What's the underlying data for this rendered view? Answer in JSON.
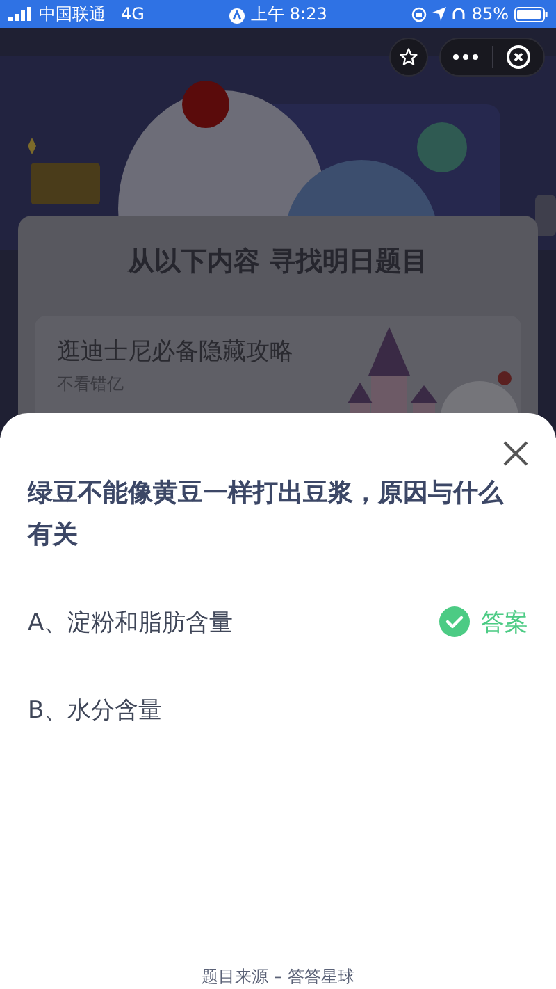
{
  "status_bar": {
    "carrier": "中国联通",
    "network": "4G",
    "time": "上午 8:23",
    "battery": "85%"
  },
  "background": {
    "title": "从以下内容 寻找明日题目",
    "article": {
      "title": "逛迪士尼必备隐藏攻略",
      "subtitle": "不看错亿"
    }
  },
  "sheet": {
    "question": "绿豆不能像黄豆一样打出豆浆，原因与什么有关",
    "options": [
      {
        "text": "A、淀粉和脂肪含量",
        "answer": true,
        "answer_label": "答案"
      },
      {
        "text": "B、水分含量",
        "answer": false
      }
    ],
    "footer": "题目来源 – 答答星球"
  }
}
